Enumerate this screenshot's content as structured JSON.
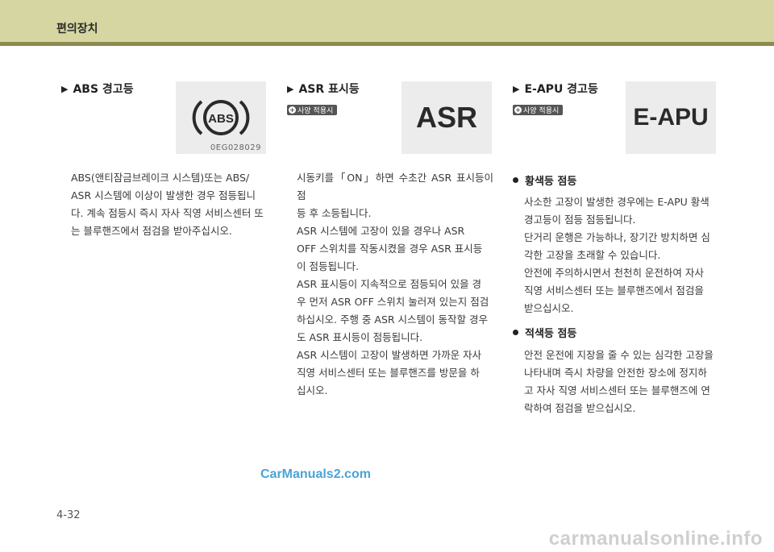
{
  "header": {
    "title": "편의장치"
  },
  "col1": {
    "title": "ABS 경고등",
    "image_code": "0EG028029",
    "lines": [
      "ABS(앤티잠금브레이크 시스템)또는 ABS/",
      "ASR 시스템에 이상이 발생한 경우 점등됩니",
      "다. 계속 점등시 즉시 자사 직영 서비스센터 또",
      "는 블루핸즈에서 점검을 받아주십시오."
    ]
  },
  "col2": {
    "title": "ASR 표시등",
    "badge": "사양 적용시",
    "image_label": "ASR",
    "lines": [
      "시동키를「ON」하면 수초간 ASR 표시등이 점",
      "등 후 소등됩니다.",
      "ASR 시스템에 고장이 있을 경우나 ASR",
      "OFF 스위치를 작동시켰을 경우 ASR 표시등",
      "이 점등됩니다.",
      "ASR 표시등이 지속적으로 점등되어 있을 경",
      "우 먼저 ASR OFF 스위치 눌러져 있는지 점검",
      "하십시오. 주행 중 ASR 시스템이 동작할 경우",
      "도 ASR 표시등이 점등됩니다.",
      "ASR 시스템이 고장이 발생하면 가까운 자사",
      "직영 서비스센터 또는 블루핸즈를 방문을 하",
      "십시오."
    ]
  },
  "col3": {
    "title": "E-APU 경고등",
    "badge": "사양 적용시",
    "image_label": "E-APU",
    "bullet1": {
      "title": "황색등 점등",
      "lines": [
        "사소한 고장이 발생한 경우에는 E-APU 황색",
        "경고등이 점등 점등됩니다.",
        "단거리 운행은 가능하나, 장기간 방치하면 심",
        "각한 고장을 초래할 수 있습니다.",
        "안전에 주의하시면서 천천히 운전하여 자사",
        "직영 서비스센터 또는 블루핸즈에서 점검을",
        "받으십시오."
      ]
    },
    "bullet2": {
      "title": "적색등 점등",
      "lines": [
        "안전 운전에 지장을 줄 수 있는 심각한 고장을",
        "나타내며 즉시 차량을 안전한 장소에 정지하",
        "고 자사 직영 서비스센터 또는 블루핸즈에 연",
        "락하여 점검을 받으십시오."
      ]
    }
  },
  "abs_icon_text": "ABS",
  "watermark": "CarManuals2.com",
  "page_number": "4-32",
  "footer_watermark": "carmanualsonline.info"
}
